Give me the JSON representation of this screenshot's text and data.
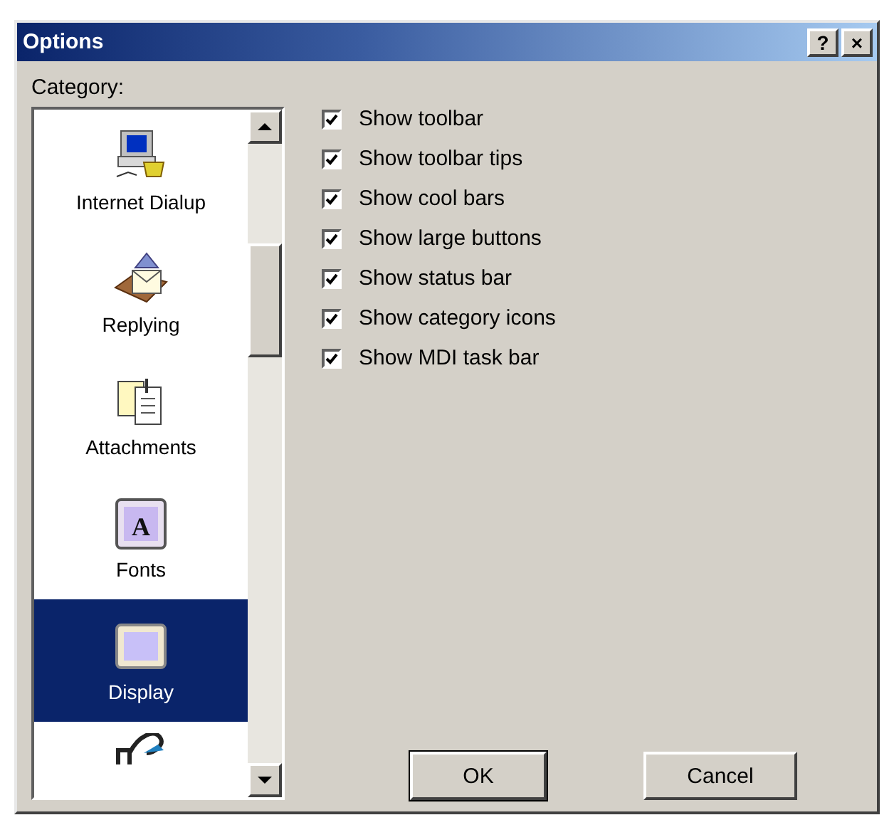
{
  "window": {
    "title": "Options",
    "buttons": [
      "?",
      "×"
    ]
  },
  "category": {
    "label": "Category:",
    "items": [
      {
        "kind": "dialup",
        "label": "Internet Dialup",
        "selected": false
      },
      {
        "kind": "replying",
        "label": "Replying",
        "selected": false
      },
      {
        "kind": "attachments",
        "label": "Attachments",
        "selected": false
      },
      {
        "kind": "fonts",
        "glyph": "A",
        "label": "Fonts",
        "selected": false
      },
      {
        "kind": "display",
        "label": "Display",
        "selected": true
      },
      {
        "kind": "partial",
        "selected": false
      }
    ]
  },
  "options": [
    {
      "label": "Show toolbar",
      "checked": true
    },
    {
      "label": "Show toolbar tips",
      "checked": true
    },
    {
      "label": "Show cool bars",
      "checked": true
    },
    {
      "label": "Show large buttons",
      "checked": true
    },
    {
      "label": "Show status bar",
      "checked": true
    },
    {
      "label": "Show category icons",
      "checked": true
    },
    {
      "label": "Show MDI task bar",
      "checked": true
    }
  ],
  "buttons": [
    "OK",
    "Cancel"
  ]
}
